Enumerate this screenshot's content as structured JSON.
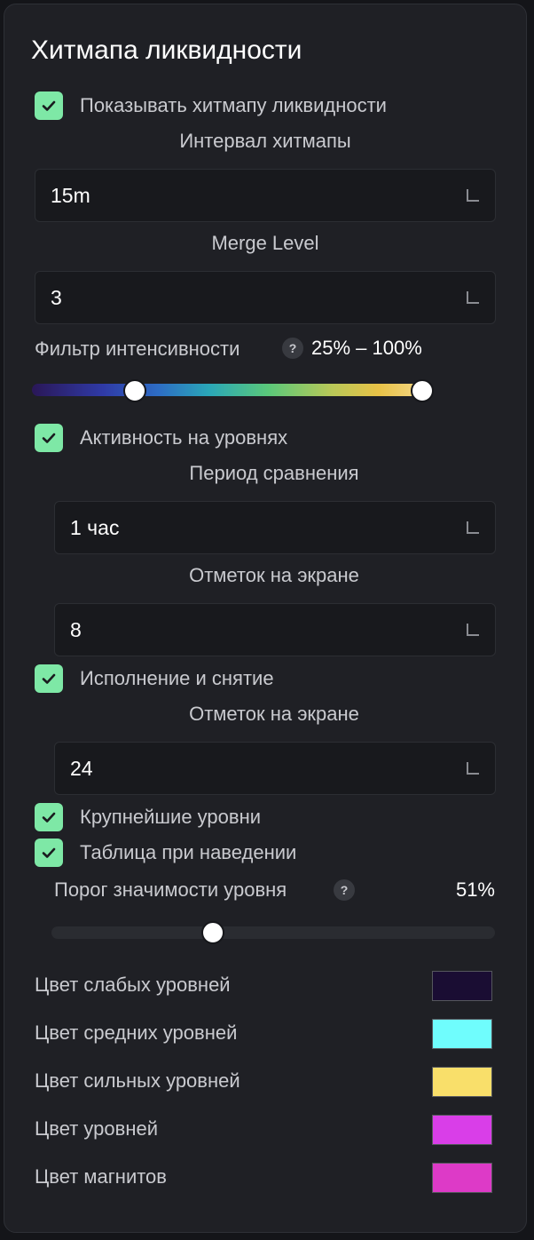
{
  "panel": {
    "title": "Хитмапа ликвидности",
    "show_heatmap": {
      "label": "Показывать хитмапу ликвидности",
      "checked": true
    },
    "heatmap_interval": {
      "label": "Интервал хитмапы",
      "value": "15m"
    },
    "merge_level": {
      "label": "Merge Level",
      "value": "3"
    },
    "intensity_filter": {
      "label": "Фильтр интенсивности",
      "help": "?",
      "range_text": "25% – 100%",
      "min_percent": 25,
      "max_percent": 100
    },
    "level_activity": {
      "label": "Активность на уровнях",
      "checked": true
    },
    "compare_period": {
      "label": "Период сравнения",
      "value": "1 час"
    },
    "marks_on_screen_1": {
      "label": "Отметок на экране",
      "value": "8"
    },
    "execution_cancel": {
      "label": "Исполнение и снятие",
      "checked": true
    },
    "marks_on_screen_2": {
      "label": "Отметок на экране",
      "value": "24"
    },
    "largest_levels": {
      "label": "Крупнейшие уровни",
      "checked": true
    },
    "hover_table": {
      "label": "Таблица при наведении",
      "checked": true
    },
    "significance_threshold": {
      "label": "Порог значимости уровня",
      "help": "?",
      "value_text": "51%",
      "percent": 51
    },
    "colors": [
      {
        "label": "Цвет слабых уровней",
        "color": "#1a0d33"
      },
      {
        "label": "Цвет средних уровней",
        "color": "#6ffdfd"
      },
      {
        "label": "Цвет сильных уровней",
        "color": "#f9df6a"
      },
      {
        "label": "Цвет уровней",
        "color": "#d93ee8"
      },
      {
        "label": "Цвет магнитов",
        "color": "#dd3ac7"
      }
    ],
    "checkbox_color": "#7ee8a6"
  }
}
